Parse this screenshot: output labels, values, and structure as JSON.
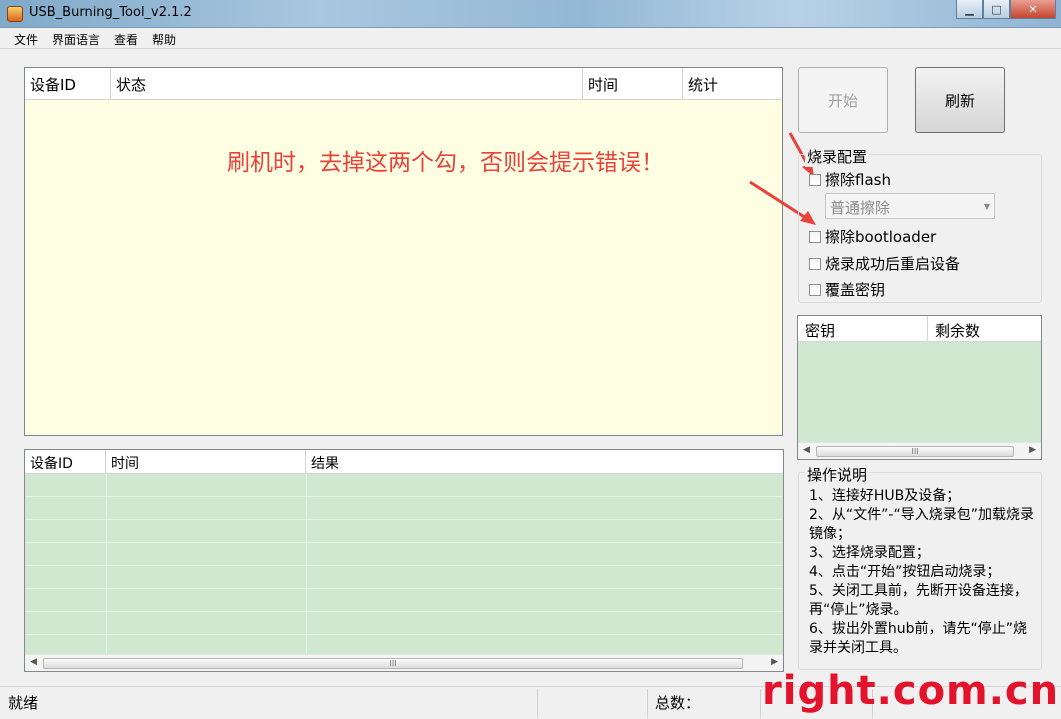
{
  "window": {
    "title": "USB_Burning_Tool_v2.1.2",
    "minimize": "▁",
    "maximize": "□",
    "close": "✕"
  },
  "menu": [
    "文件",
    "界面语言",
    "查看",
    "帮助"
  ],
  "device_list": {
    "columns": [
      "设备ID",
      "状态",
      "时间",
      "统计"
    ],
    "annotation": "刷机时，去掉这两个勾，否则会提示错误！"
  },
  "result_list": {
    "columns": [
      "设备ID",
      "时间",
      "结果"
    ],
    "scroll_thumb": "III"
  },
  "buttons": {
    "start": "开始",
    "refresh": "刷新"
  },
  "burn_config": {
    "title": "烧录配置",
    "erase_flash": {
      "label": "擦除flash",
      "checked": false
    },
    "erase_mode": "普通擦除",
    "erase_bootloader": {
      "label": "擦除bootloader",
      "checked": false
    },
    "reboot_after": {
      "label": "烧录成功后重启设备",
      "checked": false
    },
    "overwrite_key": {
      "label": "覆盖密钥",
      "checked": false
    }
  },
  "key_list": {
    "columns": [
      "密钥",
      "剩余数"
    ],
    "scroll_thumb": "III"
  },
  "instructions": {
    "title": "操作说明",
    "lines": [
      "1、连接好HUB及设备；",
      "2、从“文件”-“导入烧录包”加载烧录镜像；",
      "3、选择烧录配置；",
      "4、点击“开始”按钮启动烧录；",
      "5、关闭工具前，先断开设备连接，再“停止”烧录。",
      "6、拔出外置hub前，请先“停止”烧录并关闭工具。"
    ]
  },
  "status_bar": {
    "status": "就绪",
    "total_label": "总数："
  },
  "watermark": "right.com.cn",
  "colors": {
    "annotation": "#e8423b",
    "device_list_bg": "#fefee2",
    "result_list_bg": "#cfe8cf",
    "watermark": "#e2132b"
  }
}
